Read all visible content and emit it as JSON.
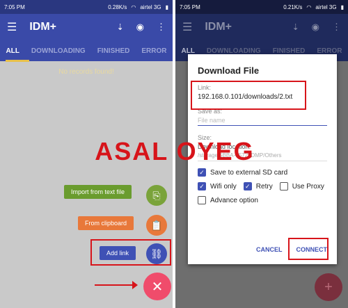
{
  "left": {
    "status": {
      "time": "7:05 PM",
      "speed": "0.28K/s",
      "carrier": "airtel 3G"
    },
    "app_title": "IDM+",
    "tabs": [
      "ALL",
      "DOWNLOADING",
      "FINISHED",
      "ERROR"
    ],
    "empty_text": "No records found!",
    "actions": {
      "import": "Import from text file",
      "clipboard": "From clipboard",
      "add_link": "Add link"
    }
  },
  "right": {
    "status": {
      "time": "7:05 PM",
      "speed": "0.21K/s",
      "carrier": "airtel 3G"
    },
    "app_title": "IDM+",
    "tabs": [
      "ALL",
      "DOWNLOADING",
      "FINISHED",
      "ERROR"
    ],
    "dialog": {
      "title": "Download File",
      "link_label": "Link:",
      "link_value": "192.168.0.101/downloads/2.txt",
      "save_as_label": "Save as:",
      "file_name_placeholder": "File name",
      "size_label": "Size:",
      "location_label": "Download location:",
      "location_value": "/storage/5BBA-6572/IDMP/Others",
      "options": {
        "sd_card": "Save to external SD card",
        "wifi_only": "Wifi only",
        "retry": "Retry",
        "use_proxy": "Use Proxy",
        "advance": "Advance option"
      },
      "cancel": "CANCEL",
      "connect": "CONNECT"
    }
  },
  "watermark": "ASAL OYEG",
  "colors": {
    "primary": "#3f51b5",
    "primary_dim": "#1f2a5c",
    "accent_fab": "#f04c6b",
    "highlight": "#d7141a",
    "chip_green": "#6a9c2e",
    "chip_orange": "#e8783a"
  }
}
